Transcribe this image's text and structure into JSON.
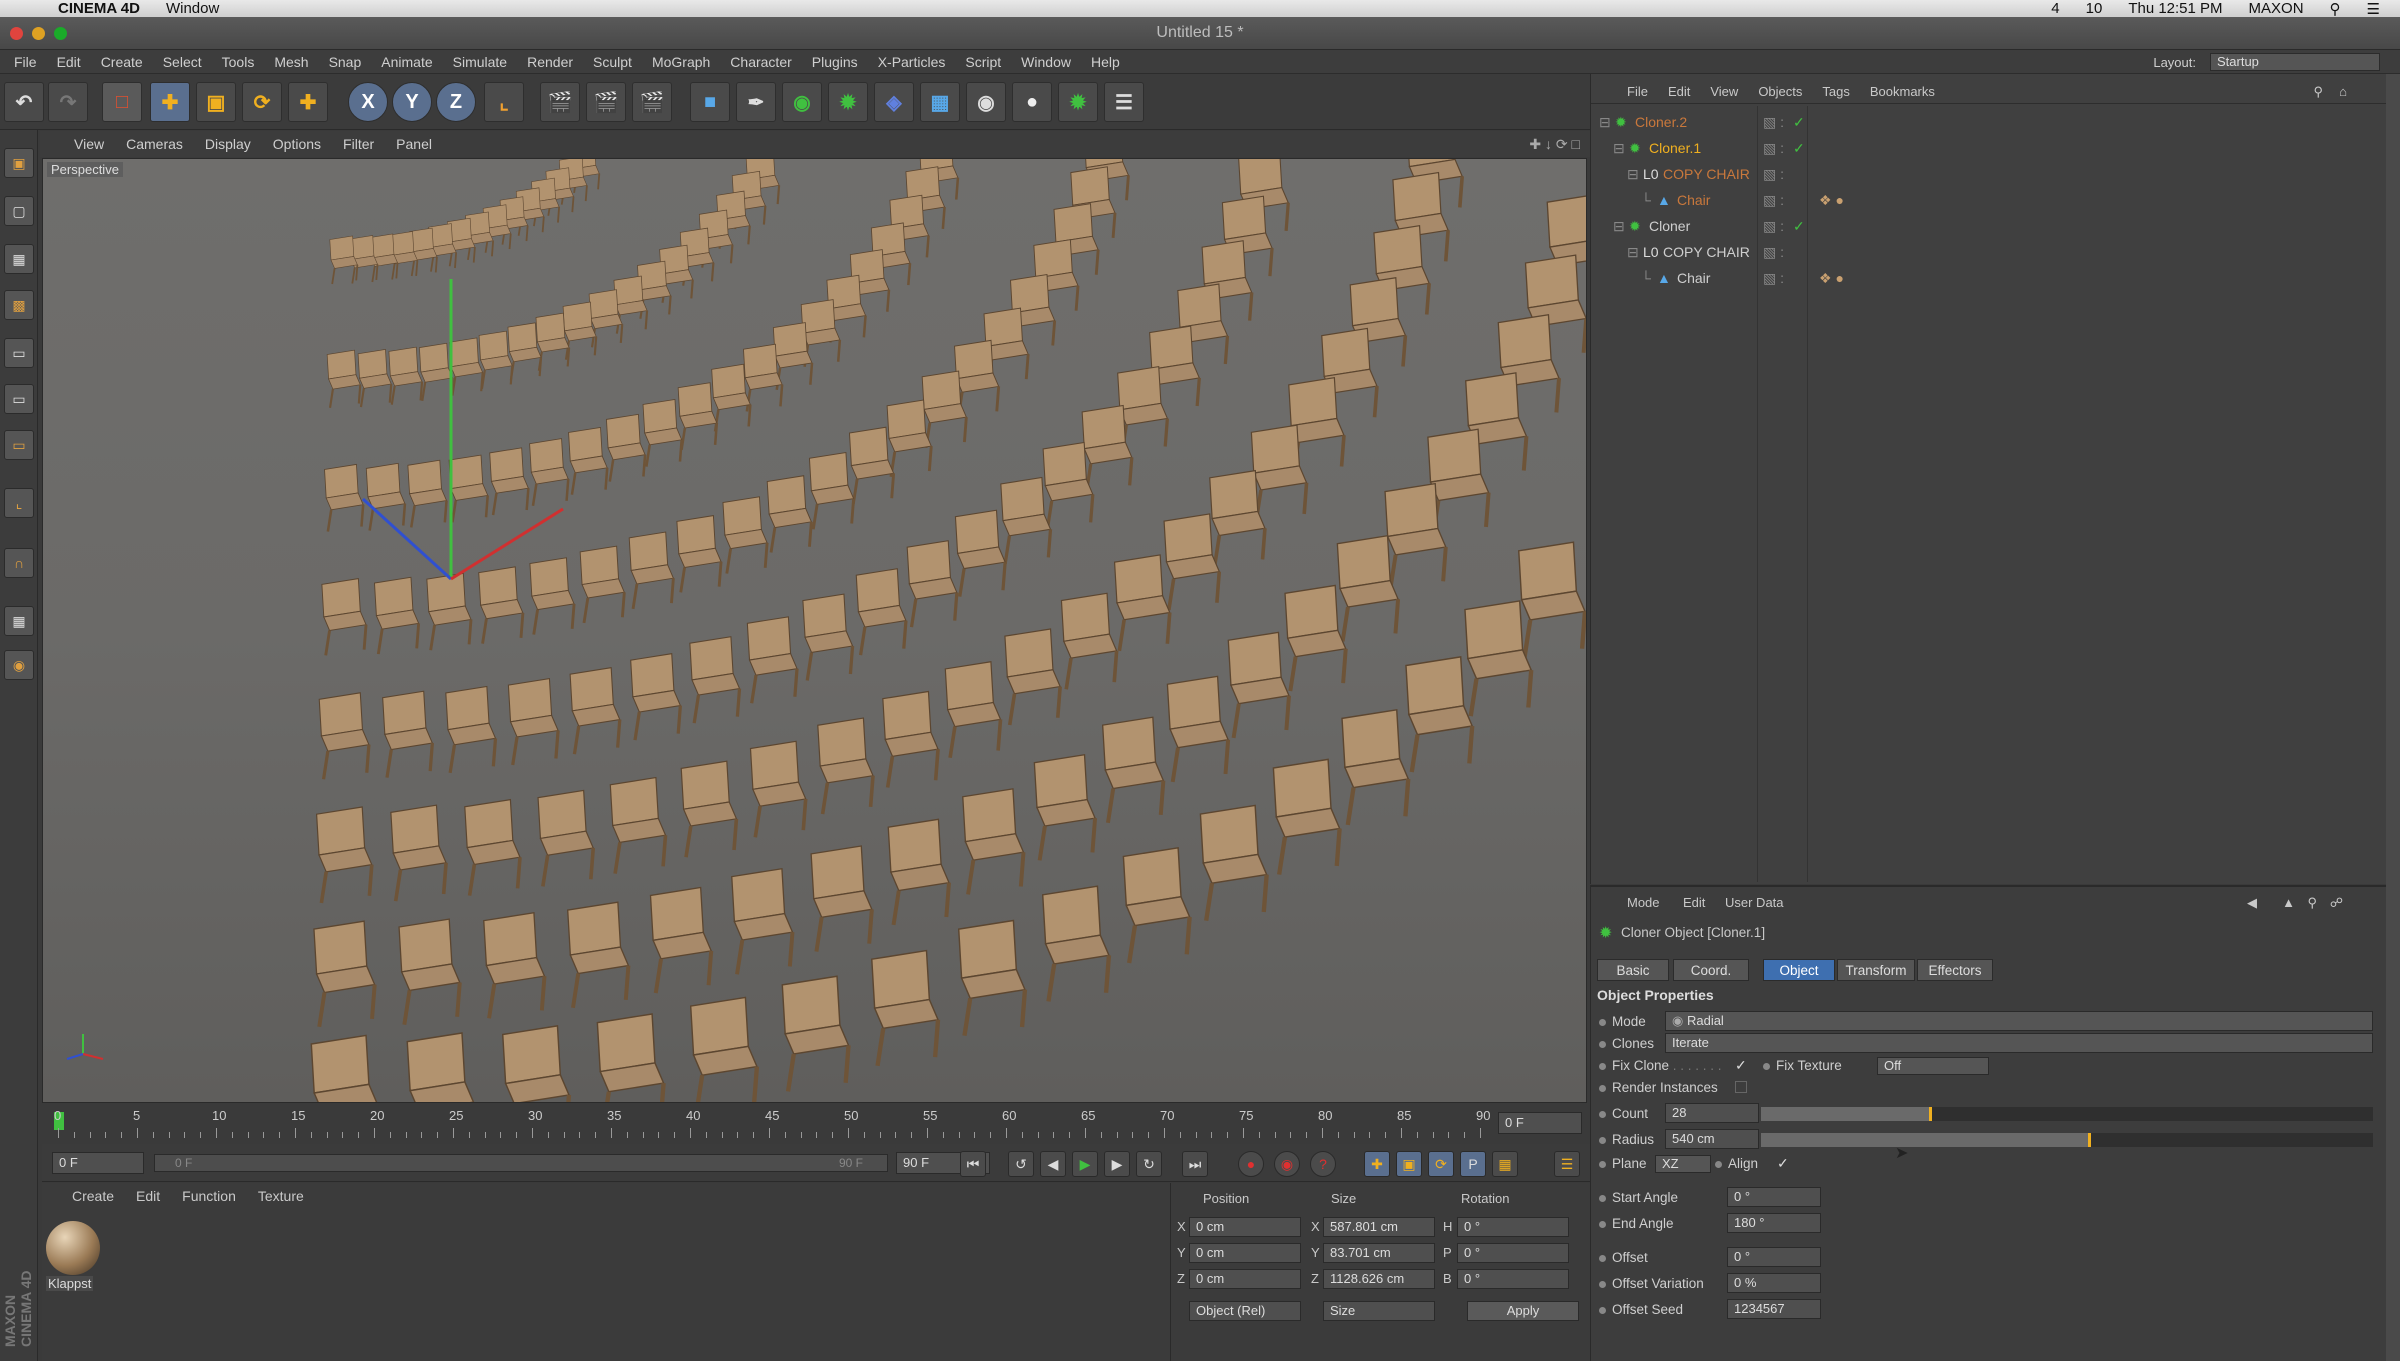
{
  "macbar": {
    "app": "CINEMA 4D",
    "window_menu": "Window",
    "status_right": [
      "4",
      "10",
      "Thu 12:51 PM",
      "MAXON"
    ]
  },
  "window": {
    "title": "Untitled 15 *"
  },
  "menu": [
    "File",
    "Edit",
    "Create",
    "Select",
    "Tools",
    "Mesh",
    "Snap",
    "Animate",
    "Simulate",
    "Render",
    "Sculpt",
    "MoGraph",
    "Character",
    "Plugins",
    "X-Particles",
    "Script",
    "Window",
    "Help"
  ],
  "layout": {
    "label": "Layout:",
    "value": "Startup"
  },
  "toolbar_icons": [
    "undo-icon",
    "redo-icon",
    "live-select-icon",
    "move-icon",
    "scale-icon",
    "rotate-icon",
    "recent-tool-icon",
    "x-axis-icon",
    "y-axis-icon",
    "z-axis-icon",
    "coordinate-system-icon",
    "render-view-icon",
    "render-picture-viewer-icon",
    "edit-render-settings-icon",
    "cube-icon",
    "pen-spline-icon",
    "subdivision-surface-icon",
    "cloner-icon",
    "deformer-icon",
    "floor-icon",
    "camera-icon",
    "light-icon",
    "generator-icon",
    "environment-icon"
  ],
  "axis_labels": [
    "X",
    "Y",
    "Z"
  ],
  "viewport": {
    "menu": [
      "View",
      "Cameras",
      "Display",
      "Options",
      "Filter",
      "Panel"
    ],
    "label": "Perspective"
  },
  "timeline": {
    "ticks": [
      "0",
      "5",
      "10",
      "15",
      "20",
      "25",
      "30",
      "35",
      "40",
      "45",
      "50",
      "55",
      "60",
      "65",
      "70",
      "75",
      "80",
      "85",
      "90"
    ],
    "current_frame": "0 F",
    "start_field": "0 F",
    "range_start": "0 F",
    "range_end": "90 F",
    "end_field": "90 F"
  },
  "material_panel": {
    "menu": [
      "Create",
      "Edit",
      "Function",
      "Texture"
    ],
    "material_name": "Klappst"
  },
  "coordinates": {
    "headers": [
      "Position",
      "Size",
      "Rotation"
    ],
    "rows": [
      {
        "axis": "X",
        "pos": "0 cm",
        "size_axis": "X",
        "size": "587.801 cm",
        "rot_axis": "H",
        "rot": "0 °"
      },
      {
        "axis": "Y",
        "pos": "0 cm",
        "size_axis": "Y",
        "size": "83.701 cm",
        "rot_axis": "P",
        "rot": "0 °"
      },
      {
        "axis": "Z",
        "pos": "0 cm",
        "size_axis": "Z",
        "size": "1128.626 cm",
        "rot_axis": "B",
        "rot": "0 °"
      }
    ],
    "mode_select": "Object (Rel)",
    "size_select": "Size",
    "apply": "Apply"
  },
  "object_manager": {
    "menu": [
      "File",
      "Edit",
      "View",
      "Objects",
      "Tags",
      "Bookmarks"
    ],
    "objects": [
      {
        "name": "Cloner.2",
        "indent": 0,
        "color": "#c9783c"
      },
      {
        "name": "Cloner.1",
        "indent": 1,
        "color": "#f0b020"
      },
      {
        "name": "COPY CHAIR",
        "indent": 2,
        "color": "#c9783c"
      },
      {
        "name": "Chair",
        "indent": 3,
        "color": "#c9783c"
      },
      {
        "name": "Cloner",
        "indent": 1,
        "color": "#cfcfcf"
      },
      {
        "name": "COPY CHAIR",
        "indent": 2,
        "color": "#cfcfcf"
      },
      {
        "name": "Chair",
        "indent": 3,
        "color": "#cfcfcf"
      }
    ]
  },
  "attributes": {
    "menu": [
      "Mode",
      "Edit",
      "User Data"
    ],
    "object_title": "Cloner Object [Cloner.1]",
    "tabs": [
      "Basic",
      "Coord.",
      "Object",
      "Transform",
      "Effectors"
    ],
    "active_tab": "Object",
    "section": "Object Properties",
    "mode_label": "Mode",
    "mode_value": "Radial",
    "clones_label": "Clones",
    "clones_value": "Iterate",
    "fix_clone_label": "Fix Clone",
    "fix_texture_label": "Fix Texture",
    "fix_texture_value": "Off",
    "render_instances_label": "Render Instances",
    "count_label": "Count",
    "count_value": "28",
    "count_fraction": 0.28,
    "radius_label": "Radius",
    "radius_value": "540 cm",
    "radius_fraction": 0.54,
    "plane_label": "Plane",
    "plane_value": "XZ",
    "align_label": "Align",
    "start_angle_label": "Start Angle",
    "start_angle_value": "0 °",
    "end_angle_label": "End Angle",
    "end_angle_value": "180 °",
    "offset_label": "Offset",
    "offset_value": "0 °",
    "offset_variation_label": "Offset Variation",
    "offset_variation_value": "0 %",
    "offset_seed_label": "Offset Seed",
    "offset_seed_value": "1234567"
  },
  "colors": {
    "accent": "#3e6fb0",
    "highlight": "#f0b020",
    "panel": "#3b3b3b"
  }
}
